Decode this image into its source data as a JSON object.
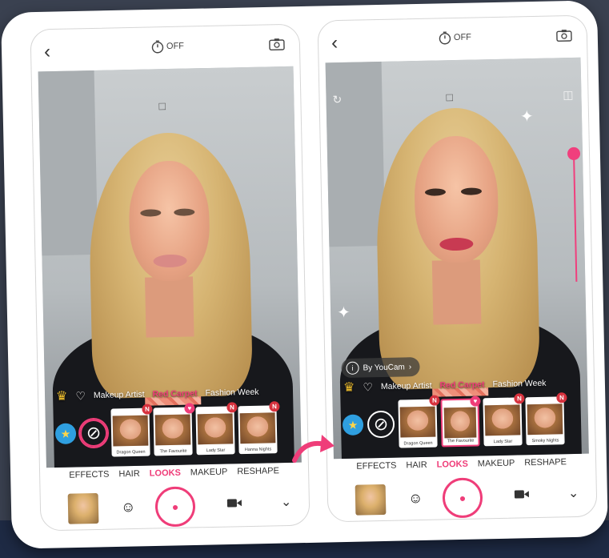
{
  "left_phone": {
    "timer": "OFF",
    "categories": [
      "Makeup Artist",
      "Red Carpet",
      "Fashion Week"
    ],
    "active_category": "Red Carpet",
    "looks": [
      {
        "tag": "",
        "caption": "Dragon Queen",
        "badge": "N",
        "selected": false
      },
      {
        "tag": "",
        "caption": "The Favourite",
        "badge": "heart",
        "selected": false
      },
      {
        "tag": "",
        "caption": "Lady Star",
        "badge": "N",
        "selected": false
      },
      {
        "tag": "",
        "caption": "Hanna Nights",
        "badge": "N",
        "selected": false
      }
    ],
    "tabs": [
      "EFFECTS",
      "HAIR",
      "LOOKS",
      "MAKEUP",
      "RESHAPE"
    ],
    "active_tab": "LOOKS"
  },
  "right_phone": {
    "timer": "OFF",
    "by_youcam": "By YouCam",
    "categories": [
      "Makeup Artist",
      "Red Carpet",
      "Fashion Week"
    ],
    "active_category": "Red Carpet",
    "looks": [
      {
        "tag": "",
        "caption": "Dragon Queen",
        "badge": "N",
        "selected": false
      },
      {
        "tag": "",
        "caption": "The Favourite",
        "badge": "heart",
        "selected": true
      },
      {
        "tag": "",
        "caption": "Lady Star",
        "badge": "N",
        "selected": false
      },
      {
        "tag": "",
        "caption": "Smoky Nights",
        "badge": "N",
        "selected": false
      }
    ],
    "tabs": [
      "EFFECTS",
      "HAIR",
      "LOOKS",
      "MAKEUP",
      "RESHAPE"
    ],
    "active_tab": "LOOKS"
  },
  "colors": {
    "accent": "#ef3d79",
    "badge": "#d7323e"
  },
  "icons": [
    "back-icon",
    "timer-icon",
    "camera-flip-icon",
    "crown-icon",
    "heart-icon",
    "gift-icon",
    "none-icon",
    "face-icon",
    "camera-icon",
    "video-icon",
    "chevron-down-icon",
    "info-icon",
    "sparkle-icon"
  ]
}
